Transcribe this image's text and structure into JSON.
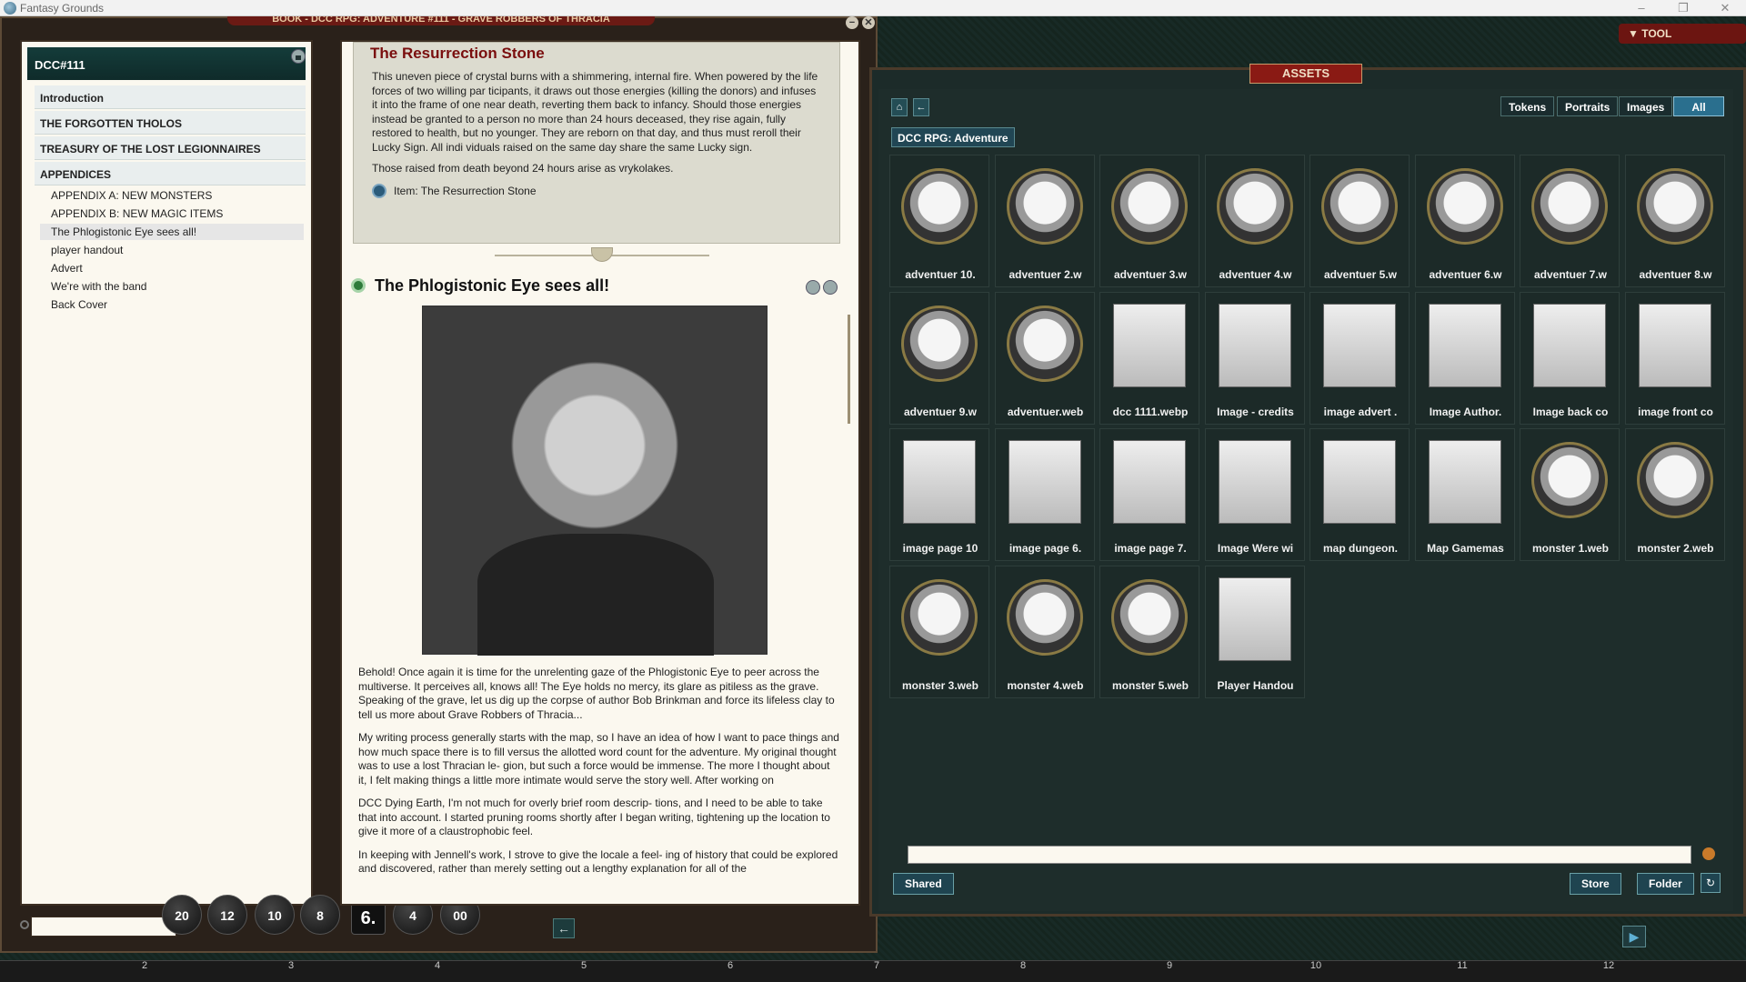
{
  "app": {
    "title": "Fantasy Grounds"
  },
  "book": {
    "window_title": "BOOK - DCC RPG: ADVENTURE #111 - GRAVE ROBBERS OF THRACIA",
    "index_title": "DCC#111",
    "sections": [
      {
        "label": "Introduction"
      },
      {
        "label": "THE FORGOTTEN THOLOS"
      },
      {
        "label": "TREASURY OF THE LOST LEGIONNAIRES"
      },
      {
        "label": "APPENDICES"
      }
    ],
    "items": [
      {
        "label": "APPENDIX A: NEW MONSTERS"
      },
      {
        "label": "APPENDIX B: NEW MAGIC ITEMS"
      },
      {
        "label": "The Phlogistonic Eye sees all!"
      },
      {
        "label": "player handout"
      },
      {
        "label": "Advert"
      },
      {
        "label": "We're with the band"
      },
      {
        "label": "Back Cover"
      }
    ]
  },
  "dice": [
    "20",
    "12",
    "10",
    "8",
    "6.",
    "4",
    "00"
  ],
  "content": {
    "res_title": "The Resurrection Stone",
    "res_paragraph": "This uneven piece of crystal burns with a shimmering, internal fire. When powered by the life forces of two willing par ticipants, it draws out those energies (killing the donors) and infuses it into the frame of one near death, reverting them back to infancy. Should those energies instead be granted to a person no more than 24 hours deceased, they rise again, fully restored to health, but no younger. They are reborn on that day, and thus must reroll their Lucky Sign. All indi viduals raised on the same day share the same Lucky sign.",
    "res_paragraph2": "Those raised from death beyond 24 hours arise as vrykolakes.",
    "res_link": "Item: The Resurrection Stone",
    "phlog_title": "The Phlogistonic Eye sees all!",
    "paragraphs": [
      "Behold! Once again it is time for the unrelenting gaze of the Phlogistonic Eye to peer across the multiverse. It perceives all, knows all! The Eye holds no mercy, its glare as pitiless as the grave. Speaking of the grave, let us dig up the corpse of author Bob Brinkman and force its lifeless clay to tell us more about Grave Robbers of Thracia...",
      "My writing process generally starts with the map, so I have an idea of how I want to pace things and how much space there is to fill versus the allotted word count for the adventure. My original thought was to use a lost Thracian le- gion, but such a force would be immense. The more I thought about it, I felt making things a little more intimate would serve the story well. After working on",
      "DCC Dying Earth, I'm not much for overly brief room descrip- tions, and I need to be able to take that into account. I started pruning rooms shortly after I began writing, tightening up the location to give it more of a claustrophobic feel.",
      "In keeping with Jennell's work, I strove to give the locale a feel- ing of history that could be explored and discovered, rather than merely setting out a lengthy explanation for all of the"
    ]
  },
  "assets": {
    "title": "ASSETS",
    "tool_label": "TOOL",
    "filters": [
      "Tokens",
      "Portraits",
      "Images",
      "All"
    ],
    "active_filter": "All",
    "folder": "DCC RPG: Adventure",
    "items": [
      {
        "label": "adventuer 10.",
        "kind": "round"
      },
      {
        "label": "adventuer 2.w",
        "kind": "round"
      },
      {
        "label": "adventuer 3.w",
        "kind": "round"
      },
      {
        "label": "adventuer 4.w",
        "kind": "round"
      },
      {
        "label": "adventuer 5.w",
        "kind": "round"
      },
      {
        "label": "adventuer 6.w",
        "kind": "round"
      },
      {
        "label": "adventuer 7.w",
        "kind": "round"
      },
      {
        "label": "adventuer 8.w",
        "kind": "round"
      },
      {
        "label": "adventuer 9.w",
        "kind": "round"
      },
      {
        "label": "adventuer.web",
        "kind": "round"
      },
      {
        "label": "dcc 1111.webp",
        "kind": "square"
      },
      {
        "label": "Image - credits",
        "kind": "square"
      },
      {
        "label": "image advert .",
        "kind": "square"
      },
      {
        "label": "Image Author.",
        "kind": "square"
      },
      {
        "label": "Image back co",
        "kind": "square"
      },
      {
        "label": "image front co",
        "kind": "square"
      },
      {
        "label": "image page 10",
        "kind": "square"
      },
      {
        "label": "image page 6.",
        "kind": "square"
      },
      {
        "label": "image page 7.",
        "kind": "square"
      },
      {
        "label": "Image Were wi",
        "kind": "square"
      },
      {
        "label": "map dungeon.",
        "kind": "square"
      },
      {
        "label": "Map Gamemas",
        "kind": "square"
      },
      {
        "label": "monster 1.web",
        "kind": "round"
      },
      {
        "label": "monster 2.web",
        "kind": "round"
      },
      {
        "label": "monster 3.web",
        "kind": "round"
      },
      {
        "label": "monster 4.web",
        "kind": "round"
      },
      {
        "label": "monster 5.web",
        "kind": "round"
      },
      {
        "label": "Player Handou",
        "kind": "square"
      }
    ],
    "shared_label": "Shared",
    "store_label": "Store",
    "folder_label": "Folder"
  },
  "hotbar": [
    "2",
    "3",
    "4",
    "5",
    "6",
    "7",
    "8",
    "9",
    "10",
    "11",
    "12"
  ]
}
